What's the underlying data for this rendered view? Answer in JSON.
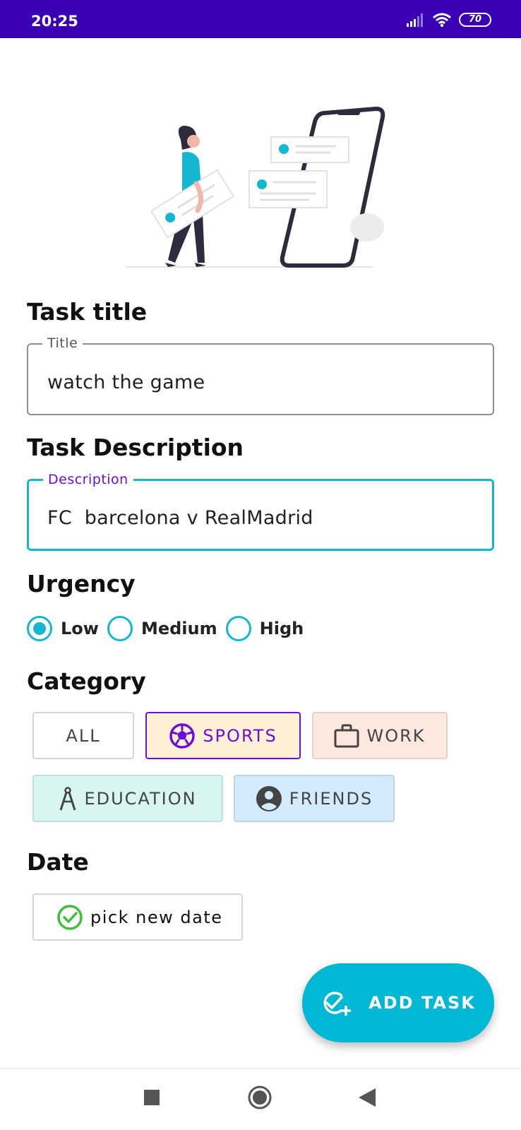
{
  "status_bar": {
    "time": "20:25",
    "battery": "70",
    "color": "#3a00b3"
  },
  "form": {
    "title_section": "Task title",
    "title_field": {
      "legend": "Title",
      "value": "watch the game"
    },
    "description_section": "Task Description",
    "description_field": {
      "legend": "Description",
      "value": "FC  barcelona v RealMadrid"
    },
    "urgency_section": "Urgency",
    "urgency_options": [
      {
        "label": "Low",
        "selected": true
      },
      {
        "label": "Medium",
        "selected": false
      },
      {
        "label": "High",
        "selected": false
      }
    ],
    "category_section": "Category",
    "categories": [
      {
        "label": "ALL",
        "icon": "none",
        "selected": false,
        "bg": "#ffffff"
      },
      {
        "label": "SPORTS",
        "icon": "soccer-ball-icon",
        "selected": true,
        "bg": "#fdf0d5"
      },
      {
        "label": "WORK",
        "icon": "briefcase-icon",
        "selected": false,
        "bg": "#fde8df"
      },
      {
        "label": "EDUCATION",
        "icon": "compass-icon",
        "selected": false,
        "bg": "#d9f5f0"
      },
      {
        "label": "FRIENDS",
        "icon": "account-icon",
        "selected": false,
        "bg": "#d4eafd"
      }
    ],
    "date_section": "Date",
    "date_button": "pick new date"
  },
  "fab": {
    "label": "ADD TASK",
    "icon": "task-add-icon",
    "color": "#00b8d4"
  },
  "colors": {
    "accent": "#14b7cf",
    "focus_label": "#6a0fd6",
    "selected_chip_border": "#6a0fd6"
  },
  "nav": {
    "icons": [
      "recents-square-icon",
      "home-circle-icon",
      "back-triangle-icon"
    ]
  }
}
